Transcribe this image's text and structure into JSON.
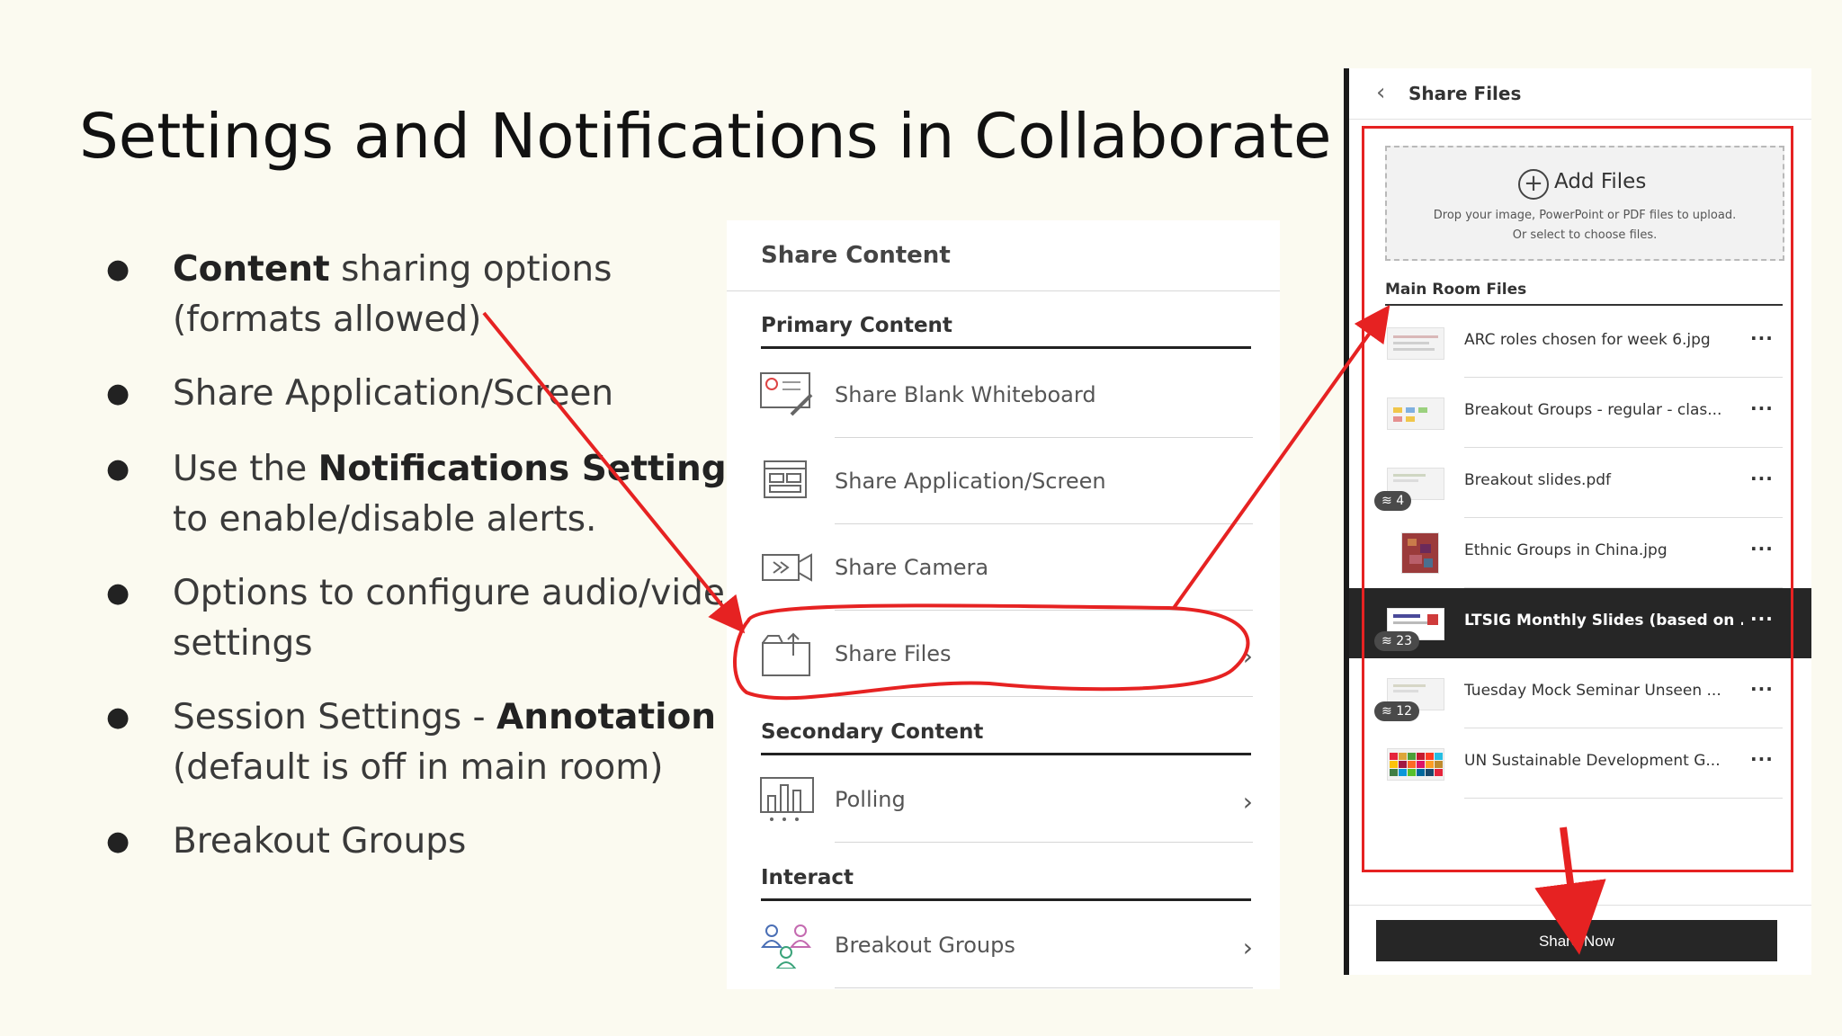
{
  "slide": {
    "title": "Settings and Notifications in Collaborate",
    "bullets": [
      {
        "bold": "Content",
        "text": " sharing options (formats allowed)"
      },
      {
        "pre": "Share Application/Screen"
      },
      {
        "pre": "Use the ",
        "bold": "Notifications Settings",
        "text": " to enable/disable alerts."
      },
      {
        "pre": "Options to configure audio/video settings"
      },
      {
        "pre": "Session Settings - ",
        "bold": "Annotation",
        "text": " (default is off in main room)"
      },
      {
        "pre": "Breakout Groups"
      }
    ]
  },
  "share_content": {
    "header": "Share Content",
    "primary_title": "Primary Content",
    "primary_items": [
      {
        "label": "Share Blank Whiteboard",
        "icon": "whiteboard-icon"
      },
      {
        "label": "Share Application/Screen",
        "icon": "screen-icon"
      },
      {
        "label": "Share Camera",
        "icon": "camera-icon"
      },
      {
        "label": "Share Files",
        "icon": "folder-icon"
      }
    ],
    "secondary_title": "Secondary Content",
    "secondary_items": [
      {
        "label": "Polling",
        "icon": "polling-icon"
      }
    ],
    "interact_title": "Interact",
    "interact_items": [
      {
        "label": "Breakout Groups",
        "icon": "breakout-groups-icon"
      }
    ]
  },
  "share_files": {
    "title": "Share Files",
    "add_files": "Add Files",
    "drop_line1": "Drop your image, PowerPoint or PDF files to upload.",
    "drop_line2": "Or select to choose files.",
    "section": "Main Room Files",
    "files": [
      {
        "name": "ARC roles chosen for week 6.jpg",
        "badge": "",
        "active": false
      },
      {
        "name": "Breakout Groups - regular - clas...",
        "badge": "",
        "active": false
      },
      {
        "name": "Breakout slides.pdf",
        "badge": "4",
        "active": false
      },
      {
        "name": "Ethnic Groups in China.jpg",
        "badge": "",
        "active": false
      },
      {
        "name": "LTSIG Monthly Slides (based on ...",
        "badge": "23",
        "active": true
      },
      {
        "name": "Tuesday Mock Seminar Unseen ...",
        "badge": "12",
        "active": false
      },
      {
        "name": "UN Sustainable Development G...",
        "badge": "",
        "active": false
      }
    ],
    "more_label": "···",
    "share_now": "Share Now"
  },
  "colors": {
    "annotation_red": "#e62222",
    "background": "#fbfaf0"
  }
}
